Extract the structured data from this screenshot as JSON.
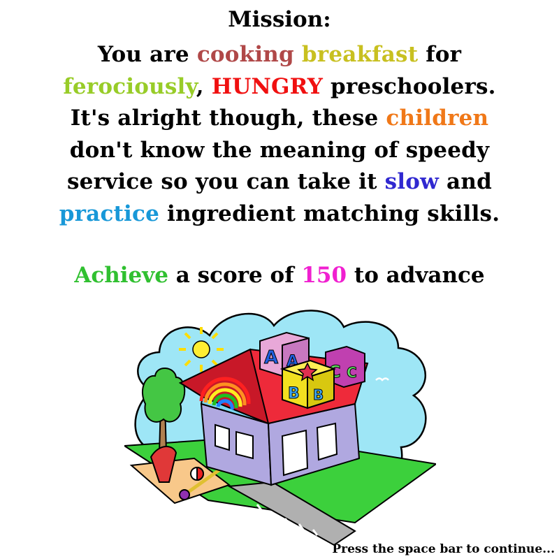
{
  "mission": {
    "title": "Mission:",
    "lines": [
      [
        {
          "text": "You are ",
          "color": "#000000"
        },
        {
          "text": "cooking",
          "color": "#b04848"
        },
        {
          "text": " ",
          "color": "#000000"
        },
        {
          "text": "breakfast",
          "color": "#c8c020"
        },
        {
          "text": " for",
          "color": "#000000"
        }
      ],
      [
        {
          "text": "ferociously",
          "color": "#98cc28"
        },
        {
          "text": ", ",
          "color": "#000000"
        },
        {
          "text": "HUNGRY",
          "color": "#f01010"
        },
        {
          "text": " preschoolers.",
          "color": "#000000"
        }
      ],
      [
        {
          "text": "It's alright though, these ",
          "color": "#000000"
        },
        {
          "text": "children",
          "color": "#f07818"
        }
      ],
      [
        {
          "text": "don't know the meaning of speedy",
          "color": "#000000"
        }
      ],
      [
        {
          "text": "service so you can take it ",
          "color": "#000000"
        },
        {
          "text": "slow",
          "color": "#3028d0"
        },
        {
          "text": " and",
          "color": "#000000"
        }
      ],
      [
        {
          "text": "practice",
          "color": "#1898d8"
        },
        {
          "text": " ingredient matching skills.",
          "color": "#000000"
        }
      ]
    ]
  },
  "goal": {
    "parts": [
      {
        "text": "Achieve",
        "color": "#30c030"
      },
      {
        "text": " a score of ",
        "color": "#000000"
      },
      {
        "text": "150",
        "color": "#f020d0"
      },
      {
        "text": " to advance",
        "color": "#000000"
      }
    ]
  },
  "illustration": {
    "block_letters": [
      "A",
      "A",
      "C",
      "C",
      "B",
      "B"
    ],
    "colors": {
      "sky": "#9ee6f6",
      "roof": "#ee2a3a",
      "wall": "#b0a8e0",
      "grass": "#3cd03c",
      "sidewalk": "#b0b0b0"
    }
  },
  "prompt": {
    "continue_text": "Press the space bar to continue..."
  }
}
